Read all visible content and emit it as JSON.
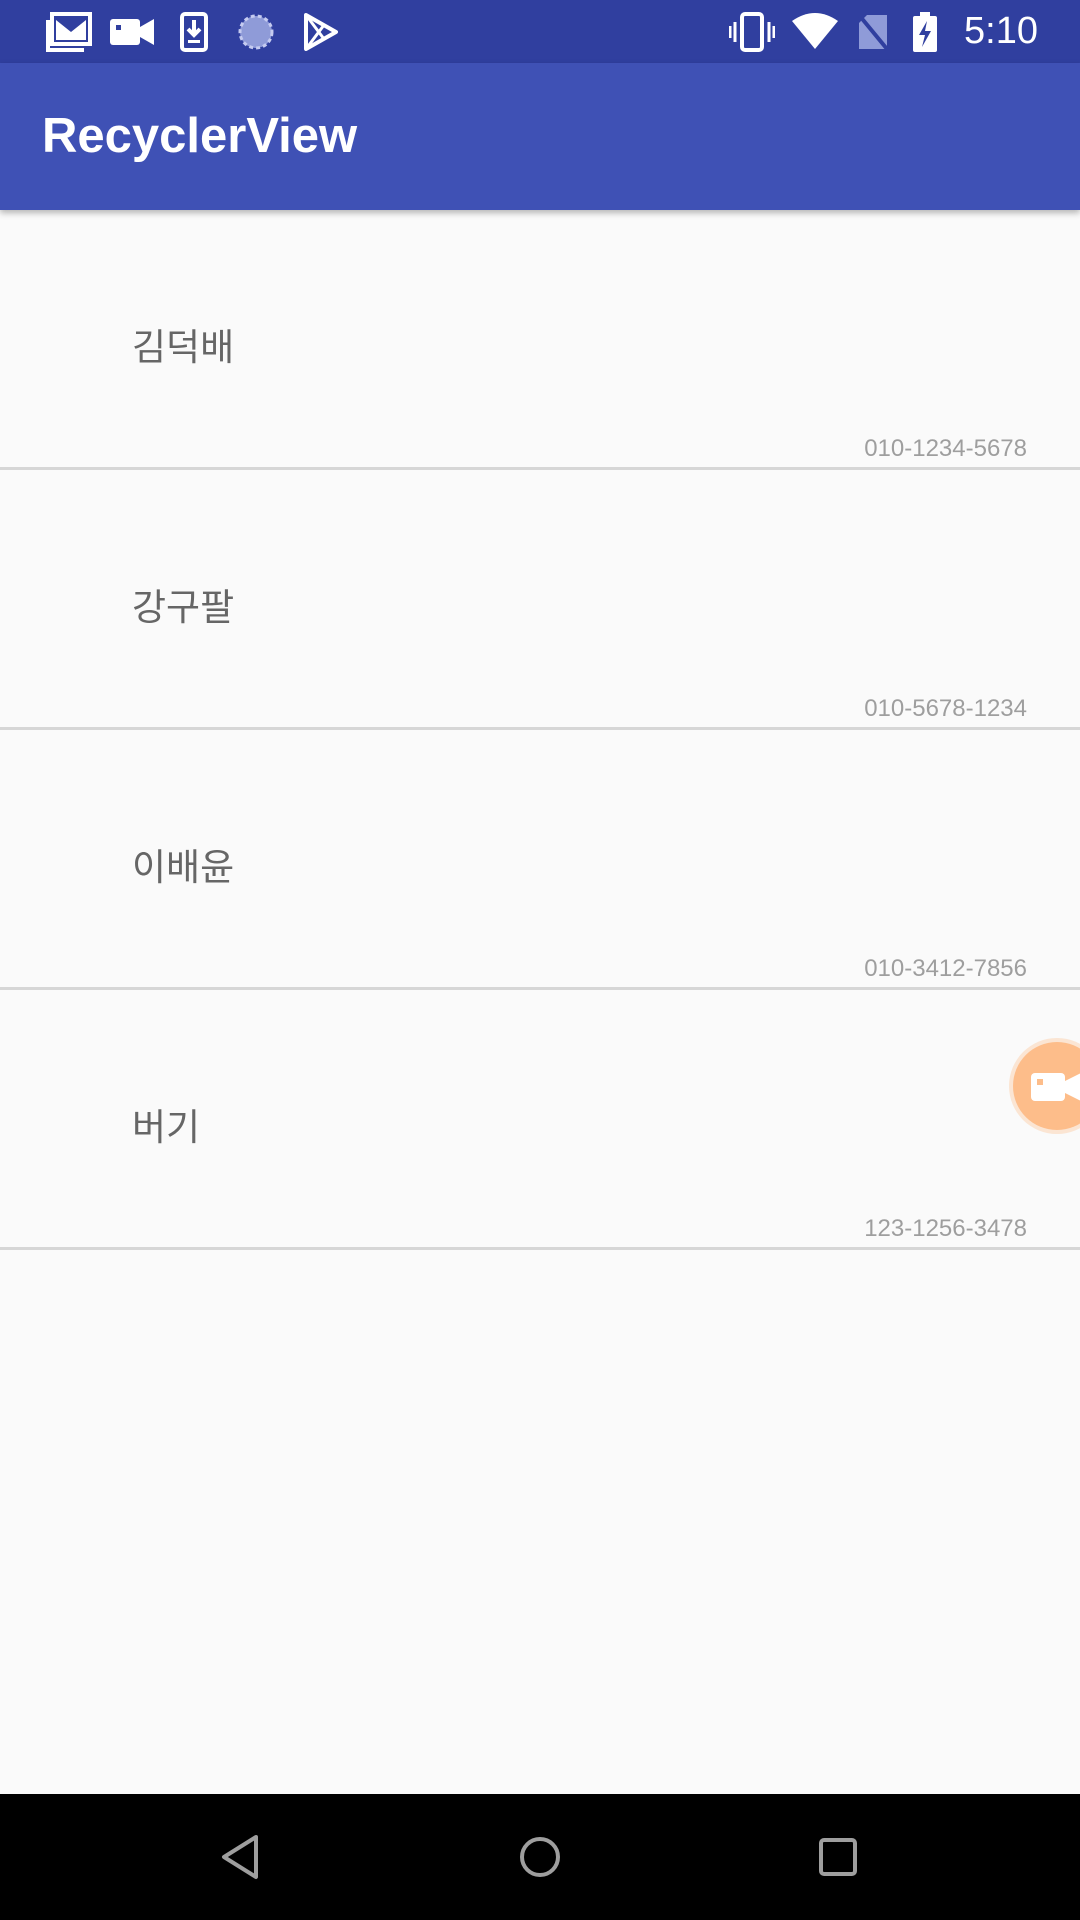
{
  "status_bar": {
    "time": "5:10",
    "left_icons": [
      "gmail-icon",
      "video-camera-icon",
      "download-icon",
      "sync-icon",
      "play-store-icon"
    ],
    "right_icons": [
      "vibrate-icon",
      "wifi-icon",
      "no-sim-icon",
      "battery-charging-icon"
    ]
  },
  "app_bar": {
    "title": "RecyclerView"
  },
  "contacts": [
    {
      "name": "김덕배",
      "phone": "010-1234-5678"
    },
    {
      "name": "강구팔",
      "phone": "010-5678-1234"
    },
    {
      "name": "이배윤",
      "phone": "010-3412-7856"
    },
    {
      "name": "버기",
      "phone": "123-1256-3478"
    }
  ],
  "floating_bubble": {
    "icon": "video-camera-icon",
    "color": "#fdbd8a"
  },
  "nav_bar": {
    "buttons": [
      "back-icon",
      "home-icon",
      "recents-icon"
    ]
  },
  "colors": {
    "status_bar": "#303f9f",
    "app_bar": "#3f51b5",
    "background": "#fafafa"
  }
}
